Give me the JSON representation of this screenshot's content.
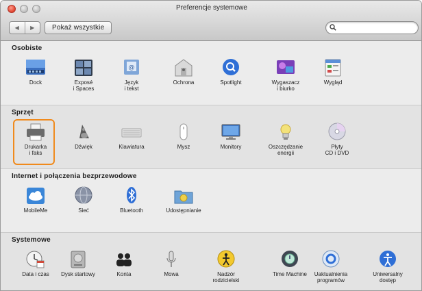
{
  "window": {
    "title": "Preferencje systemowe"
  },
  "toolbar": {
    "back_glyph": "◀",
    "forward_glyph": "▶",
    "show_all_label": "Pokaż wszystkie",
    "search": {
      "value": "",
      "placeholder": ""
    }
  },
  "sections": [
    {
      "title": "Osobiste",
      "items": [
        {
          "label": "Dock",
          "icon": "dock-icon"
        },
        {
          "label": "Exposé\ni Spaces",
          "icon": "expose-spaces-icon"
        },
        {
          "label": "Język\ni tekst",
          "icon": "language-text-icon"
        },
        {
          "label": "Ochrona",
          "icon": "security-icon"
        },
        {
          "label": "Spotlight",
          "icon": "spotlight-icon"
        },
        {
          "label": "Wygaszacz\ni biurko",
          "icon": "desktop-screensaver-icon"
        },
        {
          "label": "Wygląd",
          "icon": "appearance-icon"
        }
      ]
    },
    {
      "title": "Sprzęt",
      "items": [
        {
          "label": "Drukarka\ni faks",
          "icon": "printer-fax-icon",
          "selected": true
        },
        {
          "label": "Dźwięk",
          "icon": "sound-icon"
        },
        {
          "label": "Klawiatura",
          "icon": "keyboard-icon"
        },
        {
          "label": "Mysz",
          "icon": "mouse-icon"
        },
        {
          "label": "Monitory",
          "icon": "displays-icon"
        },
        {
          "label": "Oszczędzanie\nenergii",
          "icon": "energy-saver-icon"
        },
        {
          "label": "Płyty\nCD i DVD",
          "icon": "cd-dvd-icon"
        }
      ]
    },
    {
      "title": "Internet i połączenia bezprzewodowe",
      "items": [
        {
          "label": "MobileMe",
          "icon": "mobileme-icon"
        },
        {
          "label": "Sieć",
          "icon": "network-icon"
        },
        {
          "label": "Bluetooth",
          "icon": "bluetooth-icon"
        },
        {
          "label": "Udostępnianie",
          "icon": "sharing-icon"
        }
      ]
    },
    {
      "title": "Systemowe",
      "items": [
        {
          "label": "Data i czas",
          "icon": "date-time-icon"
        },
        {
          "label": "Dysk startowy",
          "icon": "startup-disk-icon"
        },
        {
          "label": "Konta",
          "icon": "accounts-icon"
        },
        {
          "label": "Mowa",
          "icon": "speech-icon"
        },
        {
          "label": "Nadzór\nrodzicielski",
          "icon": "parental-controls-icon"
        },
        {
          "label": "Time Machine",
          "icon": "time-machine-icon"
        },
        {
          "label": "Uaktualnienia\nprogramów",
          "icon": "software-update-icon"
        },
        {
          "label": "Uniwersalny\ndostęp",
          "icon": "universal-access-icon"
        }
      ]
    }
  ],
  "colors": {
    "highlight": "#f08a1c",
    "section_light": "#ececec",
    "section_dark": "#e3e3e3"
  }
}
